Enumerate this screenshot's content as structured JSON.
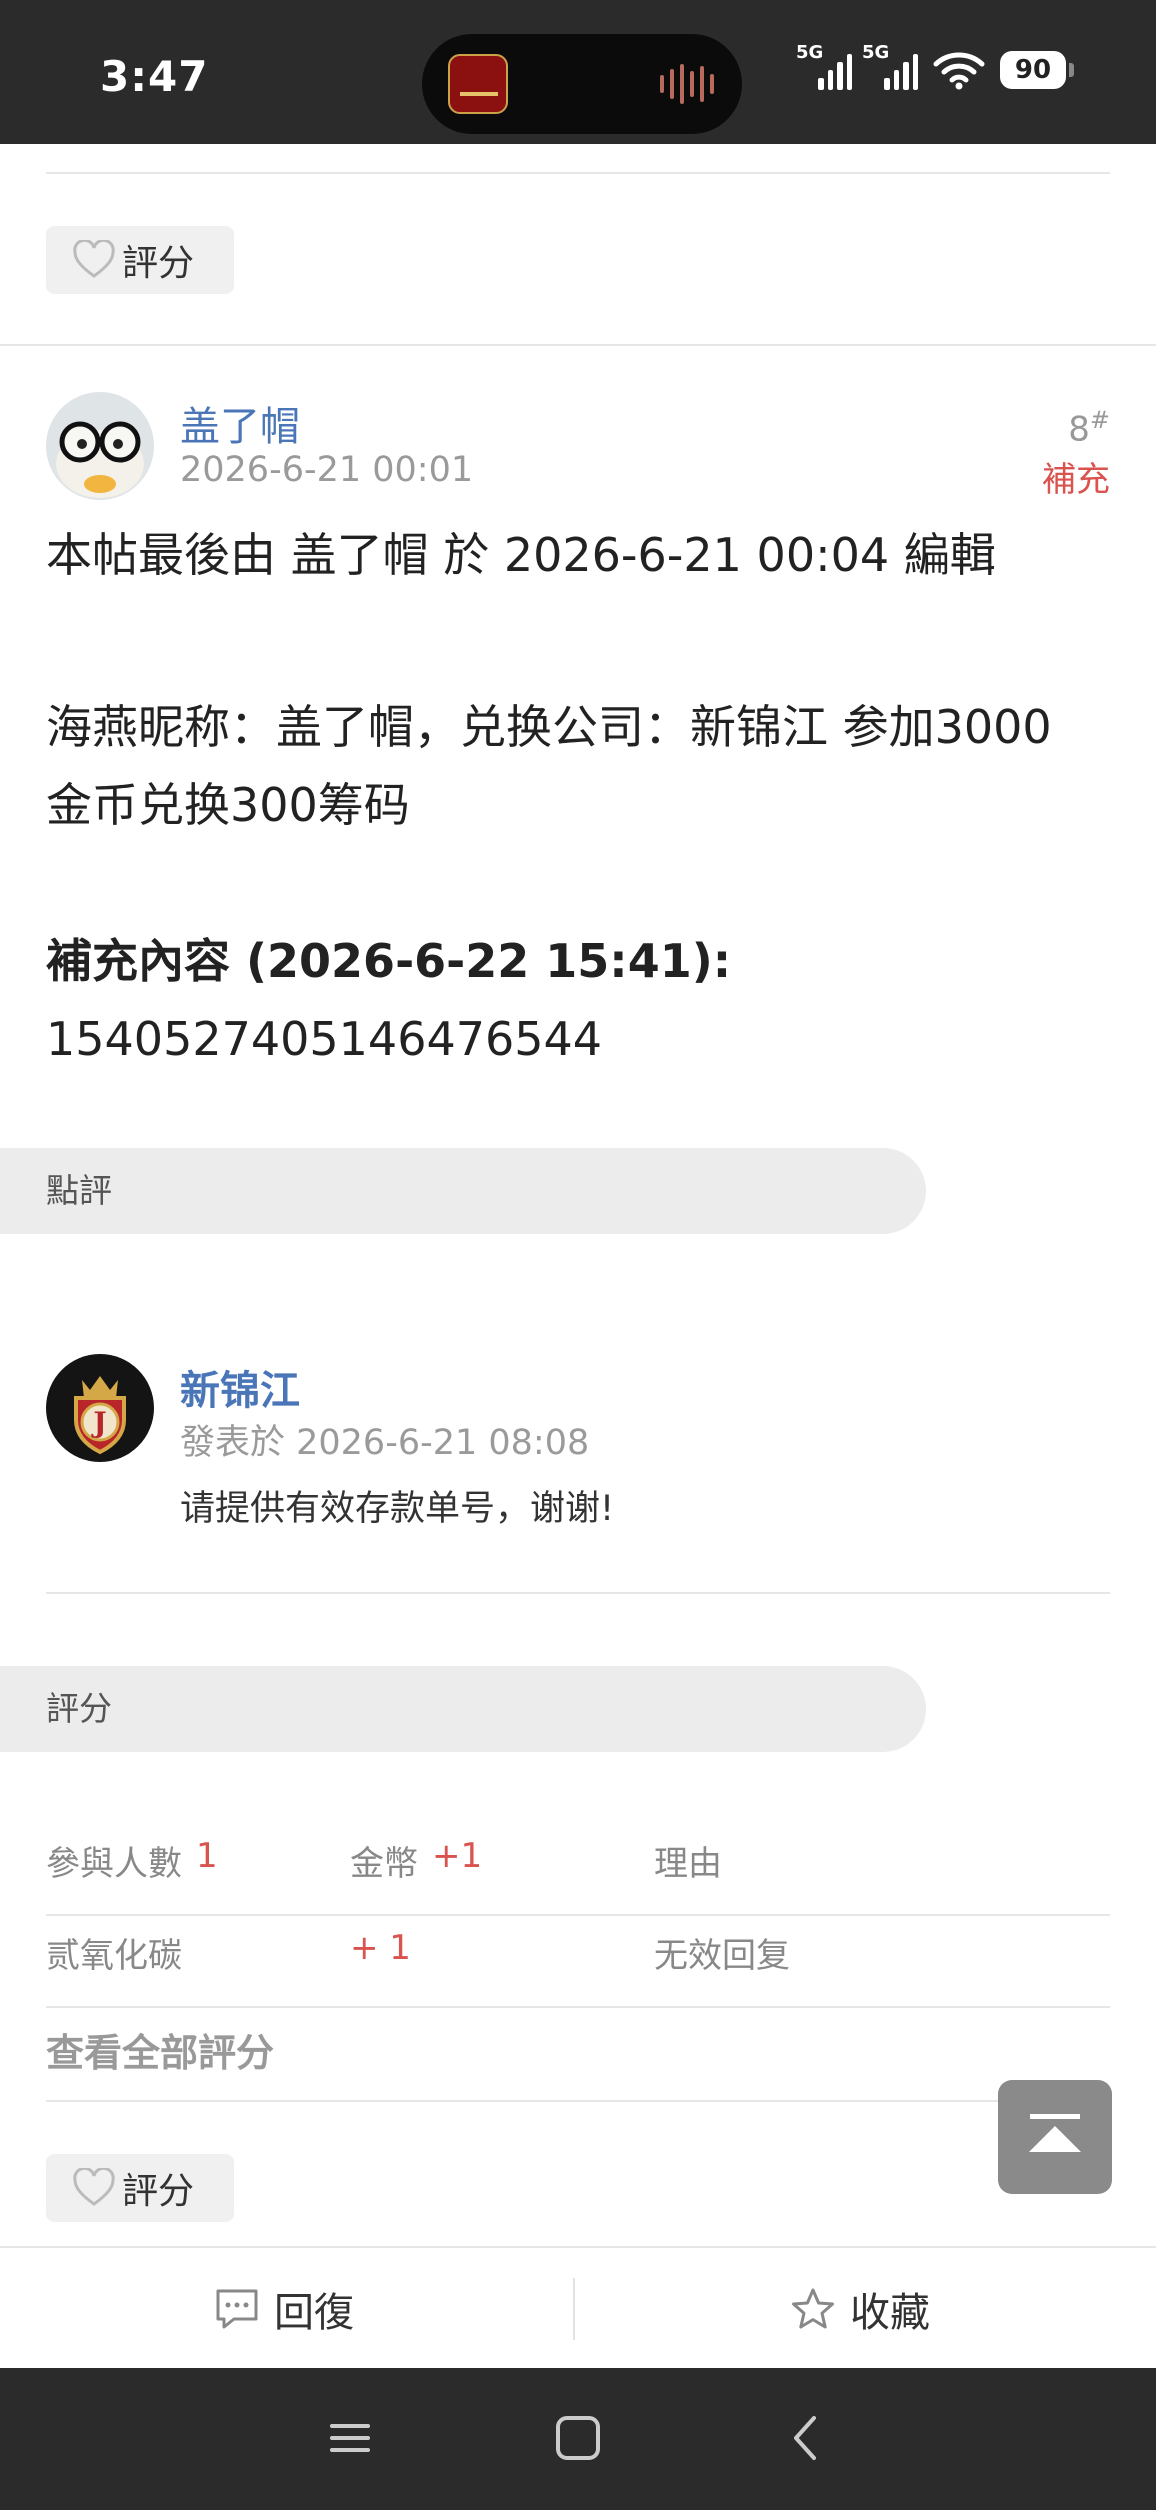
{
  "status_bar": {
    "time": "3:47",
    "network_1": "5G",
    "network_2": "5G",
    "battery": "90"
  },
  "previous_post": {
    "rate_label": "評分"
  },
  "post": {
    "author": "盖了帽",
    "date": "2026-6-21 00:01",
    "floor": "8",
    "floor_mark": "#",
    "supplement_link": "補充",
    "edit_note": "本帖最後由 盖了帽 於 2026-6-21 00:04 編輯",
    "body_line_1": "海燕昵称：盖了帽，兑换公司：新锦江  参加3000",
    "body_line_2": "金币兑换300筹码",
    "supplement_header": "補充內容 (2026-6-22 15:41):",
    "supplement_text": "1540527405146476544"
  },
  "comment_section": {
    "title": "點評",
    "comment": {
      "author": "新锦江",
      "meta": "發表於 2026-6-21 08:08",
      "text": "请提供有效存款单号，谢谢!"
    }
  },
  "rating_section": {
    "title": "評分",
    "header": {
      "participants_label": "參與人數",
      "participants_value": "1",
      "coins_label": "金幣",
      "coins_value": "+1",
      "reason_label": "理由"
    },
    "rows": [
      {
        "user": "贰氧化碳",
        "value": "+ 1",
        "reason": "无效回复"
      }
    ],
    "view_all": "查看全部評分",
    "rate_label": "評分"
  },
  "action_bar": {
    "reply": "回復",
    "favorite": "收藏"
  },
  "colors": {
    "link_blue": "#4a76b8",
    "accent_red": "#d9534f",
    "bar_dark": "#2b2b2b"
  },
  "icons": [
    "heart-outline-icon",
    "comment-icon",
    "star-outline-icon",
    "back-to-top-icon",
    "menu-icon",
    "home-icon",
    "back-icon",
    "wifi-icon",
    "signal-icon"
  ]
}
